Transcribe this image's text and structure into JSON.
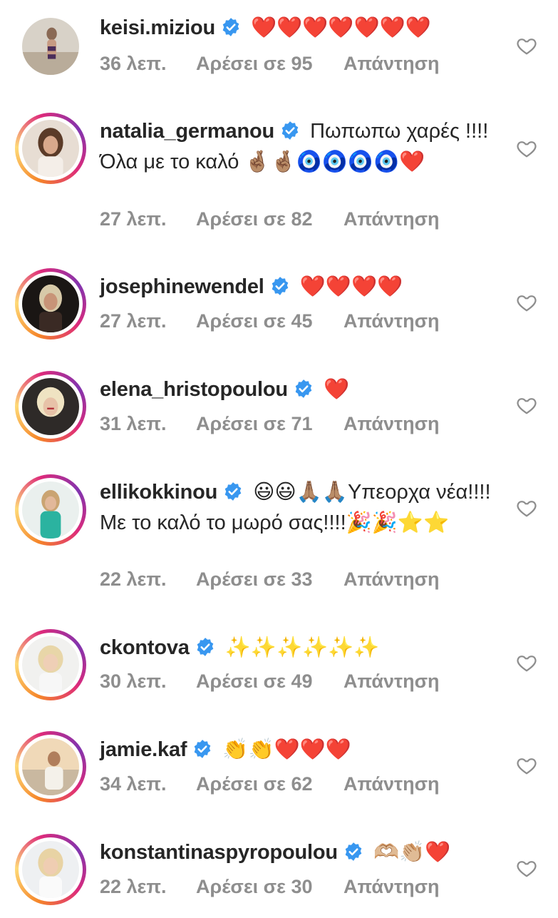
{
  "colors": {
    "primary_text": "#262626",
    "secondary_text": "#8e8e8e",
    "verified_blue": "#3897f0",
    "story_ring": [
      "#f58529",
      "#dd2a7b",
      "#8134af"
    ]
  },
  "comments": [
    {
      "username": "keisi.miziou",
      "verified": true,
      "text": "❤️❤️❤️❤️❤️❤️❤️",
      "time": "36 λεπ.",
      "likes": "Αρέσει σε 95",
      "reply": "Απάντηση",
      "avatar": "avatar-photo",
      "story_ring": false
    },
    {
      "username": "natalia_germanou",
      "verified": true,
      "text": "Πωπωπω χαρές !!!! Όλα με το καλό 🤞🏽🤞🏽🧿🧿🧿🧿❤️",
      "time": "27 λεπ.",
      "likes": "Αρέσει σε 82",
      "reply": "Απάντηση",
      "avatar": "avatar-photo",
      "story_ring": true
    },
    {
      "username": "josephinewendel",
      "verified": true,
      "text": "❤️❤️❤️❤️",
      "time": "27 λεπ.",
      "likes": "Αρέσει σε 45",
      "reply": "Απάντηση",
      "avatar": "avatar-photo",
      "story_ring": true
    },
    {
      "username": "elena_hristopoulou",
      "verified": true,
      "text": "❤️",
      "time": "31 λεπ.",
      "likes": "Αρέσει σε 71",
      "reply": "Απάντηση",
      "avatar": "avatar-photo",
      "story_ring": true
    },
    {
      "username": "ellikokkinou",
      "verified": true,
      "text": "😃😃🙏🏽🙏🏽Υπεορχα νέα!!!!\nΜε το καλό το μωρό σας!!!!🎉🎉⭐⭐",
      "time": "22 λεπ.",
      "likes": "Αρέσει σε 33",
      "reply": "Απάντηση",
      "avatar": "avatar-photo",
      "story_ring": true
    },
    {
      "username": "ckontova",
      "verified": true,
      "text": "✨✨✨✨✨✨",
      "time": "30 λεπ.",
      "likes": "Αρέσει σε 49",
      "reply": "Απάντηση",
      "avatar": "avatar-photo",
      "story_ring": true
    },
    {
      "username": "jamie.kaf",
      "verified": true,
      "text": "👏👏❤️❤️❤️",
      "time": "34 λεπ.",
      "likes": "Αρέσει σε 62",
      "reply": "Απάντηση",
      "avatar": "avatar-photo",
      "story_ring": true
    },
    {
      "username": "konstantinaspyropoulou",
      "verified": true,
      "text": "🫶🏼👏🏼❤️",
      "time": "22 λεπ.",
      "likes": "Αρέσει σε 30",
      "reply": "Απάντηση",
      "avatar": "avatar-photo",
      "story_ring": true
    }
  ],
  "icons": {
    "verified": "verified-badge-icon",
    "like": "heart-outline-icon"
  }
}
